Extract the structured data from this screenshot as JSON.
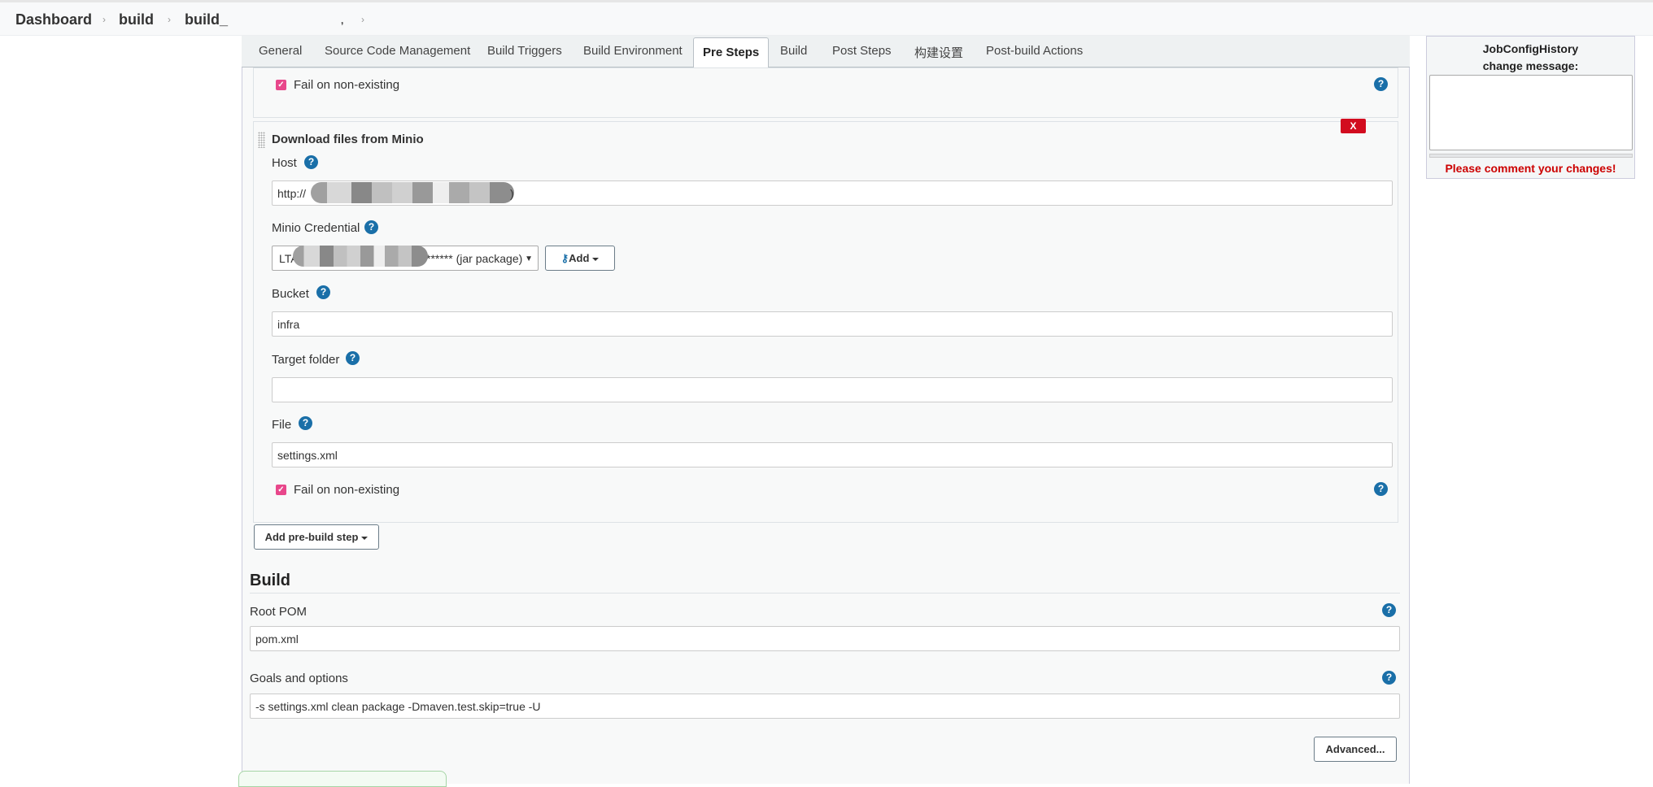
{
  "breadcrumb": {
    "items": [
      "Dashboard",
      "build",
      "build_",
      ","
    ]
  },
  "tabs": [
    {
      "label": "General"
    },
    {
      "label": "Source Code Management"
    },
    {
      "label": "Build Triggers"
    },
    {
      "label": "Build Environment"
    },
    {
      "label": "Pre Steps"
    },
    {
      "label": "Build"
    },
    {
      "label": "Post Steps"
    },
    {
      "label": "构建设置"
    },
    {
      "label": "Post-build Actions"
    }
  ],
  "active_tab": "Pre Steps",
  "prev_step": {
    "fail_label": "Fail on non-existing",
    "checked": true
  },
  "minio_step": {
    "title": "Download files from Minio",
    "delete_label": "X",
    "host_label": "Host",
    "host_value_prefix": "http://",
    "host_value_suffix": ")",
    "credential_label": "Minio Credential",
    "credential_value_prefix": "LTA",
    "credential_value_suffix": "****** (jar package)",
    "add_label": "Add",
    "bucket_label": "Bucket",
    "bucket_value": "infra",
    "target_label": "Target folder",
    "target_value": "",
    "file_label": "File",
    "file_value": "settings.xml",
    "fail_label": "Fail on non-existing",
    "fail_checked": true
  },
  "add_prebuild_label": "Add pre-build step",
  "build": {
    "title": "Build",
    "root_pom_label": "Root POM",
    "root_pom_value": "pom.xml",
    "goals_label": "Goals and options",
    "goals_value": "-s settings.xml clean package -Dmaven.test.skip=true -U",
    "advanced_label": "Advanced..."
  },
  "side": {
    "title_line1": "JobConfigHistory",
    "title_line2": "change message:",
    "warning": "Please comment your changes!",
    "warning_color": "#cc0000"
  },
  "help_glyph": "?",
  "colors": {
    "accent": "#1a6fa8",
    "checkbox": "#e8478b",
    "delete": "#d20c1f"
  }
}
